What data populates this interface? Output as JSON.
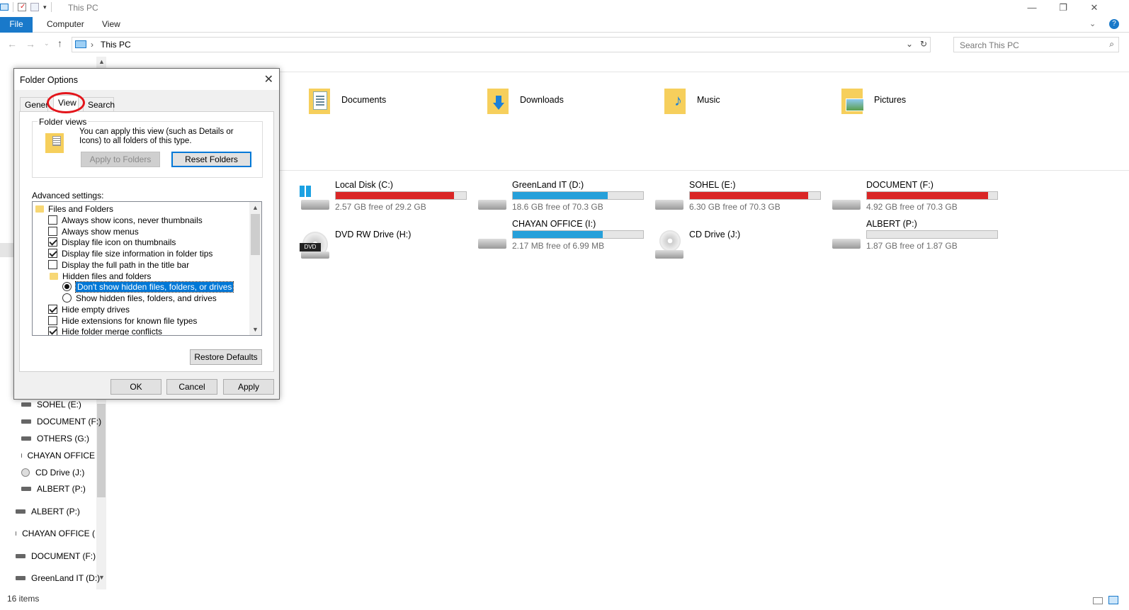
{
  "window": {
    "title": "This PC",
    "controls": {
      "minimize": "—",
      "restore": "❐",
      "close": "✕"
    }
  },
  "ribbon": {
    "tabs": [
      {
        "label": "File"
      },
      {
        "label": "Computer"
      },
      {
        "label": "View"
      }
    ]
  },
  "address": {
    "crumb": "This PC",
    "search_placeholder": "Search This PC"
  },
  "nav": {
    "items": [
      {
        "label": "SOHEL (E:)"
      },
      {
        "label": "DOCUMENT (F:)"
      },
      {
        "label": "OTHERS (G:)"
      },
      {
        "label": "CHAYAN OFFICE"
      },
      {
        "label": "CD Drive (J:)"
      },
      {
        "label": "ALBERT (P:)"
      },
      {
        "label": "ALBERT (P:)"
      },
      {
        "label": "CHAYAN OFFICE ("
      },
      {
        "label": "DOCUMENT (F:)"
      },
      {
        "label": "GreenLand IT (D:)"
      }
    ]
  },
  "folders": [
    {
      "label": "Documents",
      "icon": "documents-folder-icon"
    },
    {
      "label": "Downloads",
      "icon": "downloads-folder-icon"
    },
    {
      "label": "Music",
      "icon": "music-folder-icon"
    },
    {
      "label": "Pictures",
      "icon": "pictures-folder-icon"
    }
  ],
  "drives": [
    {
      "name": "Local Disk (C:)",
      "free": "2.57 GB free of 29.2 GB",
      "used_fraction": 0.91,
      "bar_color": "#da2626"
    },
    {
      "name": "GreenLand IT (D:)",
      "free": "18.6 GB free of 70.3 GB",
      "used_fraction": 0.73,
      "bar_color": "#26a0da"
    },
    {
      "name": "SOHEL (E:)",
      "free": "6.30 GB free of 70.3 GB",
      "used_fraction": 0.91,
      "bar_color": "#da2626"
    },
    {
      "name": "DOCUMENT (F:)",
      "free": "4.92 GB free of 70.3 GB",
      "used_fraction": 0.93,
      "bar_color": "#da2626"
    },
    {
      "name": "DVD RW Drive (H:)",
      "free": "",
      "used_fraction": null,
      "bar_color": ""
    },
    {
      "name": "CHAYAN OFFICE (I:)",
      "free": "2.17 MB free of 6.99 MB",
      "used_fraction": 0.69,
      "bar_color": "#26a0da"
    },
    {
      "name": "CD Drive (J:)",
      "free": "",
      "used_fraction": null,
      "bar_color": ""
    },
    {
      "name": "ALBERT (P:)",
      "free": "1.87 GB free of 1.87 GB",
      "used_fraction": 0.0,
      "bar_color": "#26a0da"
    }
  ],
  "status": {
    "items": "16 items"
  },
  "dialog": {
    "title": "Folder Options",
    "tabs": [
      {
        "label": "General"
      },
      {
        "label": "View"
      },
      {
        "label": "Search"
      }
    ],
    "folder_views": {
      "group": "Folder views",
      "text": "You can apply this view (such as Details or Icons) to all folders of this type.",
      "apply_btn": "Apply to Folders",
      "reset_btn": "Reset Folders"
    },
    "advanced_label": "Advanced settings:",
    "settings": [
      {
        "type": "folder",
        "label": "Files and Folders"
      },
      {
        "type": "check",
        "label": "Always show icons, never thumbnails",
        "checked": false
      },
      {
        "type": "check",
        "label": "Always show menus",
        "checked": false
      },
      {
        "type": "check",
        "label": "Display file icon on thumbnails",
        "checked": true
      },
      {
        "type": "check",
        "label": "Display file size information in folder tips",
        "checked": true
      },
      {
        "type": "check",
        "label": "Display the full path in the title bar",
        "checked": false
      },
      {
        "type": "folder",
        "label": "Hidden files and folders"
      },
      {
        "type": "radio",
        "label": "Don't show hidden files, folders, or drives",
        "checked": true,
        "selected": true
      },
      {
        "type": "radio",
        "label": "Show hidden files, folders, and drives",
        "checked": false
      },
      {
        "type": "check",
        "label": "Hide empty drives",
        "checked": true
      },
      {
        "type": "check",
        "label": "Hide extensions for known file types",
        "checked": false
      },
      {
        "type": "check",
        "label": "Hide folder merge conflicts",
        "checked": true
      }
    ],
    "restore_btn": "Restore Defaults",
    "ok": "OK",
    "cancel": "Cancel",
    "apply": "Apply"
  }
}
